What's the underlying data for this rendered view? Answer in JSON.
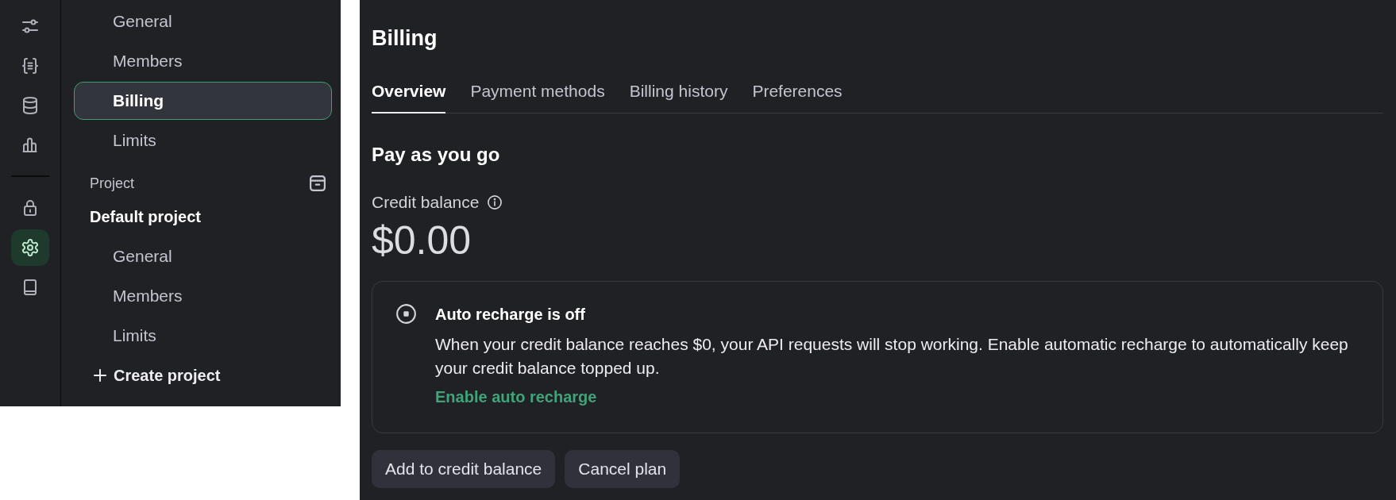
{
  "icon_rail": {
    "top": [
      {
        "selected": false
      },
      {
        "selected": false
      },
      {
        "selected": false
      },
      {
        "selected": false
      }
    ],
    "bottom": [
      {
        "selected": false
      },
      {
        "selected": true
      },
      {
        "selected": false
      }
    ]
  },
  "sidebar": {
    "org_items": [
      {
        "label": "General",
        "selected": false
      },
      {
        "label": "Members",
        "selected": false
      },
      {
        "label": "Billing",
        "selected": true
      },
      {
        "label": "Limits",
        "selected": false
      }
    ],
    "project": {
      "heading": "Project",
      "name": "Default project",
      "items": [
        {
          "label": "General",
          "selected": false
        },
        {
          "label": "Members",
          "selected": false
        },
        {
          "label": "Limits",
          "selected": false
        }
      ],
      "create_label": "Create project"
    }
  },
  "main": {
    "title": "Billing",
    "tabs": [
      {
        "label": "Overview",
        "selected": true
      },
      {
        "label": "Payment methods",
        "selected": false
      },
      {
        "label": "Billing history",
        "selected": false
      },
      {
        "label": "Preferences",
        "selected": false
      }
    ],
    "section_title": "Pay as you go",
    "credit_balance": {
      "label": "Credit balance",
      "amount": "$0.00"
    },
    "auto_recharge": {
      "on": false,
      "title": "Auto recharge is off",
      "description": "When your credit balance reaches $0, your API requests will stop working. Enable automatic recharge to automatically keep your credit balance topped up.",
      "link": "Enable auto recharge"
    },
    "buttons": [
      {
        "label": "Add to credit balance"
      },
      {
        "label": "Cancel plan"
      }
    ]
  }
}
